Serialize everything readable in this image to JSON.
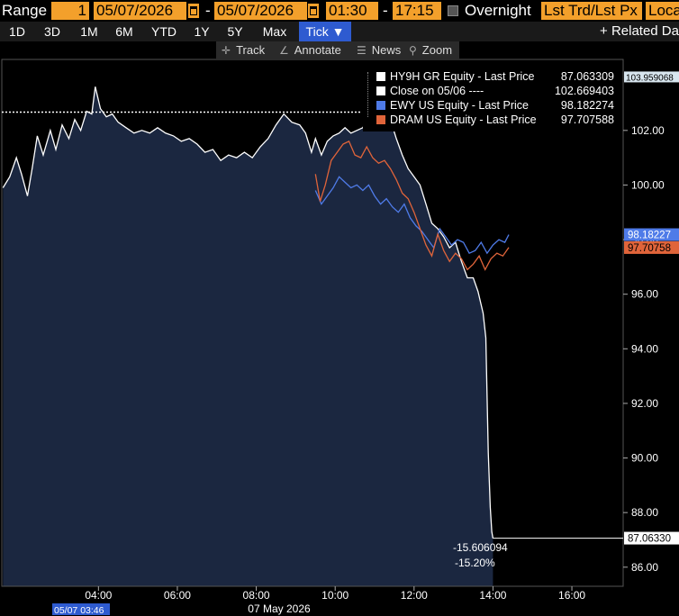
{
  "controls": {
    "range_label": "Range",
    "range_value": "1",
    "start_date": "05/07/2026",
    "end_date": "05/07/2026",
    "start_time": "01:30",
    "end_time": "17:15",
    "overnight_label": "Overnight",
    "price_type": "Lst Trd/Lst Px",
    "timezone": "Loca",
    "separator": "-"
  },
  "range_buttons": [
    "1D",
    "3D",
    "1M",
    "6M",
    "YTD",
    "1Y",
    "5Y",
    "Max",
    "Tick ▼"
  ],
  "related_label": "+ Related Da",
  "toolbar": {
    "track": "Track",
    "annotate": "Annotate",
    "news": "News",
    "zoom": "Zoom"
  },
  "colors": {
    "background": "#000000",
    "area_fill": "#1b2740",
    "hy9h": "#ffffff",
    "ewy": "#4f7be8",
    "dram": "#e0643a",
    "orange_ui": "#f3a02b"
  },
  "legend": [
    {
      "name": "HY9H GR Equity - Last Price",
      "value": "87.063309",
      "color": "#ffffff"
    },
    {
      "name": "Close on 05/06 ----",
      "value": "102.669403",
      "color": "#ffffff"
    },
    {
      "name": "EWY US Equity - Last Price",
      "value": "98.182274",
      "color": "#4f7be8"
    },
    {
      "name": "DRAM US Equity - Last Price",
      "value": "97.707588",
      "color": "#e0643a"
    }
  ],
  "axis_tags": {
    "top": "103.959068",
    "ewy": "98.18227",
    "dram": "97.70758",
    "hy9h": "87.06330"
  },
  "change": {
    "abs": "-15.606094",
    "pct": "-15.20%"
  },
  "cursor_label": "05/07 03:46",
  "date_label": "07 May 2026",
  "chart_data": {
    "type": "line",
    "title": "",
    "xlabel": "07 May 2026",
    "ylabel": "",
    "ylim": [
      85.3,
      104.6
    ],
    "xlim_hours": [
      1.55,
      17.3
    ],
    "y_ticks": [
      "86.00",
      "88.00",
      "90.00",
      "92.00",
      "94.00",
      "96.00",
      "98.00",
      "100.00",
      "102.00"
    ],
    "x_ticks": [
      "04:00",
      "06:00",
      "08:00",
      "10:00",
      "12:00",
      "14:00",
      "16:00"
    ],
    "reference_line": {
      "name": "Close on 05/06",
      "value": 102.669403
    },
    "series": [
      {
        "name": "HY9H GR Equity - Last Price",
        "style": "area",
        "color": "#ffffff",
        "points": [
          [
            1.58,
            99.9
          ],
          [
            1.75,
            100.3
          ],
          [
            1.92,
            101.0
          ],
          [
            2.05,
            100.4
          ],
          [
            2.2,
            99.6
          ],
          [
            2.32,
            100.6
          ],
          [
            2.45,
            101.8
          ],
          [
            2.6,
            101.1
          ],
          [
            2.78,
            102.0
          ],
          [
            2.92,
            101.3
          ],
          [
            3.08,
            102.2
          ],
          [
            3.25,
            101.7
          ],
          [
            3.4,
            102.4
          ],
          [
            3.55,
            102.0
          ],
          [
            3.7,
            102.7
          ],
          [
            3.83,
            102.6
          ],
          [
            3.92,
            103.6
          ],
          [
            4.05,
            102.8
          ],
          [
            4.2,
            102.5
          ],
          [
            4.35,
            102.6
          ],
          [
            4.5,
            102.3
          ],
          [
            4.7,
            102.1
          ],
          [
            4.9,
            101.9
          ],
          [
            5.1,
            102.0
          ],
          [
            5.3,
            101.9
          ],
          [
            5.5,
            102.1
          ],
          [
            5.7,
            101.9
          ],
          [
            5.9,
            101.8
          ],
          [
            6.1,
            101.6
          ],
          [
            6.3,
            101.7
          ],
          [
            6.5,
            101.5
          ],
          [
            6.7,
            101.2
          ],
          [
            6.9,
            101.3
          ],
          [
            7.1,
            100.9
          ],
          [
            7.3,
            101.1
          ],
          [
            7.5,
            101.0
          ],
          [
            7.7,
            101.2
          ],
          [
            7.9,
            101.0
          ],
          [
            8.1,
            101.4
          ],
          [
            8.3,
            101.7
          ],
          [
            8.5,
            102.2
          ],
          [
            8.7,
            102.6
          ],
          [
            8.9,
            102.3
          ],
          [
            9.1,
            102.2
          ],
          [
            9.25,
            101.9
          ],
          [
            9.4,
            101.2
          ],
          [
            9.5,
            101.7
          ],
          [
            9.65,
            101.1
          ],
          [
            9.8,
            101.6
          ],
          [
            9.95,
            101.8
          ],
          [
            10.1,
            101.9
          ],
          [
            10.25,
            102.1
          ],
          [
            10.4,
            101.9
          ],
          [
            10.55,
            102.0
          ],
          [
            10.7,
            102.1
          ],
          [
            10.85,
            102.5
          ],
          [
            11.0,
            102.3
          ],
          [
            11.1,
            102.7
          ],
          [
            11.25,
            102.2
          ],
          [
            11.4,
            102.4
          ],
          [
            11.55,
            101.7
          ],
          [
            11.7,
            101.1
          ],
          [
            11.85,
            100.6
          ],
          [
            12.0,
            100.3
          ],
          [
            12.15,
            100.0
          ],
          [
            12.3,
            99.3
          ],
          [
            12.45,
            98.6
          ],
          [
            12.6,
            98.4
          ],
          [
            12.75,
            98.1
          ],
          [
            12.9,
            97.7
          ],
          [
            13.05,
            97.9
          ],
          [
            13.2,
            97.2
          ],
          [
            13.35,
            96.6
          ],
          [
            13.5,
            96.6
          ],
          [
            13.62,
            96.1
          ],
          [
            13.75,
            95.3
          ],
          [
            13.82,
            94.4
          ],
          [
            13.88,
            90.2
          ],
          [
            13.93,
            88.2
          ],
          [
            13.97,
            87.3
          ],
          [
            14.0,
            87.06
          ]
        ]
      },
      {
        "name": "EWY US Equity - Last Price",
        "style": "line",
        "color": "#4f7be8",
        "points": [
          [
            9.5,
            99.8
          ],
          [
            9.65,
            99.3
          ],
          [
            9.8,
            99.6
          ],
          [
            9.95,
            99.9
          ],
          [
            10.1,
            100.3
          ],
          [
            10.25,
            100.1
          ],
          [
            10.4,
            99.9
          ],
          [
            10.55,
            100.0
          ],
          [
            10.7,
            99.8
          ],
          [
            10.85,
            100.0
          ],
          [
            11.0,
            99.6
          ],
          [
            11.15,
            99.3
          ],
          [
            11.3,
            99.5
          ],
          [
            11.45,
            99.2
          ],
          [
            11.6,
            99.0
          ],
          [
            11.75,
            99.3
          ],
          [
            11.9,
            98.8
          ],
          [
            12.05,
            98.5
          ],
          [
            12.2,
            98.3
          ],
          [
            12.35,
            98.0
          ],
          [
            12.5,
            97.7
          ],
          [
            12.65,
            98.4
          ],
          [
            12.8,
            98.1
          ],
          [
            12.95,
            97.8
          ],
          [
            13.1,
            98.0
          ],
          [
            13.25,
            97.9
          ],
          [
            13.4,
            97.5
          ],
          [
            13.55,
            97.6
          ],
          [
            13.7,
            97.9
          ],
          [
            13.85,
            97.5
          ],
          [
            14.0,
            97.8
          ],
          [
            14.15,
            98.0
          ],
          [
            14.3,
            97.9
          ],
          [
            14.4,
            98.18
          ]
        ]
      },
      {
        "name": "DRAM US Equity - Last Price",
        "style": "line",
        "color": "#e0643a",
        "points": [
          [
            9.5,
            100.4
          ],
          [
            9.62,
            99.4
          ],
          [
            9.75,
            100.0
          ],
          [
            9.9,
            100.9
          ],
          [
            10.05,
            101.2
          ],
          [
            10.2,
            101.5
          ],
          [
            10.35,
            101.6
          ],
          [
            10.5,
            101.1
          ],
          [
            10.65,
            101.0
          ],
          [
            10.8,
            101.4
          ],
          [
            10.95,
            101.0
          ],
          [
            11.1,
            100.8
          ],
          [
            11.25,
            100.9
          ],
          [
            11.4,
            100.6
          ],
          [
            11.55,
            100.2
          ],
          [
            11.7,
            99.7
          ],
          [
            11.85,
            99.5
          ],
          [
            12.0,
            99.0
          ],
          [
            12.15,
            98.4
          ],
          [
            12.3,
            97.8
          ],
          [
            12.45,
            97.4
          ],
          [
            12.6,
            98.2
          ],
          [
            12.75,
            97.6
          ],
          [
            12.9,
            97.2
          ],
          [
            13.05,
            97.5
          ],
          [
            13.2,
            97.3
          ],
          [
            13.35,
            96.9
          ],
          [
            13.5,
            97.1
          ],
          [
            13.65,
            97.4
          ],
          [
            13.8,
            96.9
          ],
          [
            13.95,
            97.3
          ],
          [
            14.1,
            97.5
          ],
          [
            14.25,
            97.4
          ],
          [
            14.4,
            97.71
          ]
        ]
      }
    ]
  }
}
